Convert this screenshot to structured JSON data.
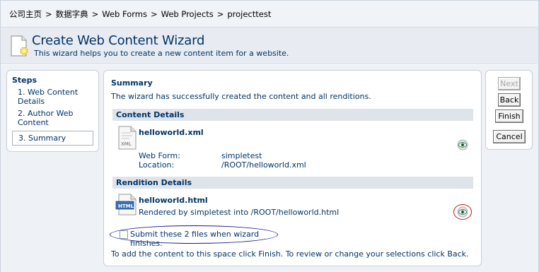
{
  "breadcrumb": {
    "items": [
      "公司主页",
      "数据字典",
      "Web Forms",
      "Web Projects",
      "projecttest"
    ],
    "separator": ">"
  },
  "header": {
    "title": "Create Web Content Wizard",
    "subtitle": "This wizard helps you to create a new content item for a website."
  },
  "steps": {
    "title": "Steps",
    "items": [
      {
        "label": "1. Web Content Details"
      },
      {
        "label": "2. Author Web Content"
      },
      {
        "label": "3. Summary"
      }
    ]
  },
  "summary": {
    "title": "Summary",
    "description": "The wizard has successfully created the content and all renditions.",
    "content_details": {
      "heading": "Content Details",
      "file_name": "helloworld.xml",
      "file_icon_label": "XML",
      "web_form_label": "Web Form:",
      "web_form_value": "simpletest",
      "location_label": "Location:",
      "location_value": "/ROOT/helloworld.xml"
    },
    "rendition_details": {
      "heading": "Rendition Details",
      "file_name": "helloworld.html",
      "file_icon_label": "HTML",
      "rendered_text": "Rendered by simpletest into /ROOT/helloworld.html"
    },
    "submit_label": "Submit these 2 files when wizard finishes.",
    "submit_checked": false,
    "footer": "To add the content to this space click Finish. To review or change your selections click Back."
  },
  "buttons": {
    "next": "Next",
    "back": "Back",
    "finish": "Finish",
    "cancel": "Cancel"
  },
  "colors": {
    "title_blue": "#003366",
    "section_bar": "#dfe4ea",
    "highlight_red": "#cc1111",
    "highlight_navy": "#1a1a8c"
  }
}
